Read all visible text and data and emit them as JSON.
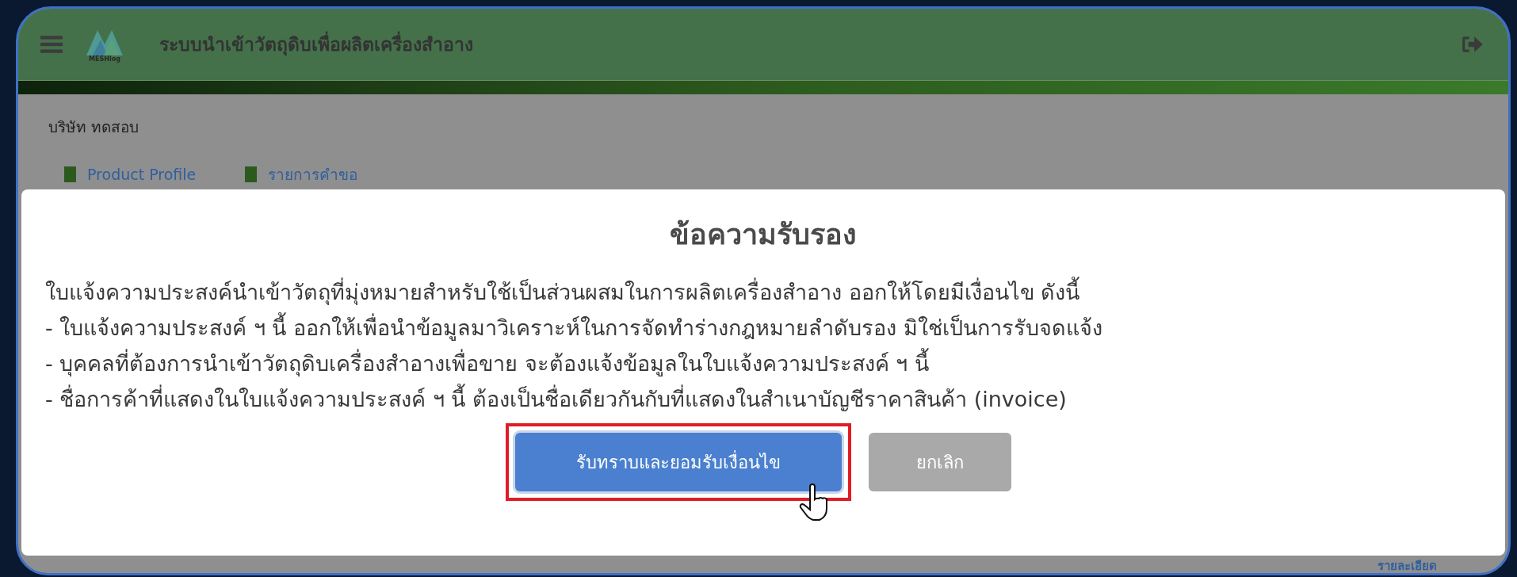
{
  "header": {
    "title": "ระบบนำเข้าวัตถุดิบเพื่อผลิตเครื่องสำอาง",
    "logo_text": "MESHlog"
  },
  "company": "บริษัท ทดสอบ",
  "links": [
    {
      "label": "Product Profile"
    },
    {
      "label": "รายการคำขอ"
    }
  ],
  "footer_link": "รายละเอียด",
  "dialog": {
    "title": "ข้อความรับรอง",
    "lines": [
      "ใบแจ้งความประสงค์นำเข้าวัตถุที่มุ่งหมายสำหรับใช้เป็นส่วนผสมในการผลิตเครื่องสำอาง ออกให้โดยมีเงื่อนไข ดังนี้",
      "- ใบแจ้งความประสงค์ ฯ นี้ ออกให้เพื่อนำข้อมูลมาวิเคราะห์ในการจัดทำร่างกฎหมายลำดับรอง มิใช่เป็นการรับจดแจ้ง",
      "- บุคคลที่ต้องการนำเข้าวัตถุดิบเครื่องสำอางเพื่อขาย จะต้องแจ้งข้อมูลในใบแจ้งความประสงค์ ฯ นี้",
      "- ชื่อการค้าที่แสดงในใบแจ้งความประสงค์ ฯ นี้ ต้องเป็นชื่อเดียวกันกับที่แสดงในสำเนาบัญชีราคาสินค้า (invoice)"
    ],
    "buttons": [
      {
        "label": "รับทราบและยอมรับเงื่อนไข",
        "kind": "primary",
        "highlighted": true
      },
      {
        "label": "ยกเลิก",
        "kind": "secondary",
        "highlighted": false
      }
    ]
  }
}
